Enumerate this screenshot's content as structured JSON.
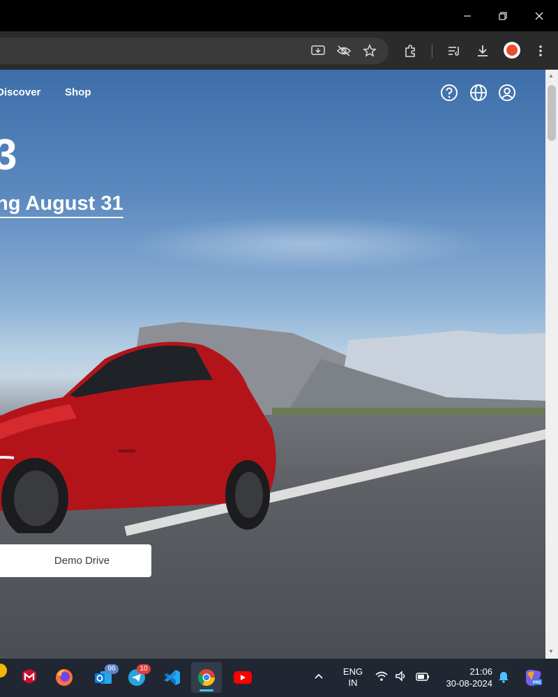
{
  "browser": {
    "window_controls": {
      "minimize": "minimize-icon",
      "maximize": "restore-icon",
      "close": "close-icon"
    },
    "toolbar_icons": [
      "install-app-icon",
      "eye-off-icon",
      "star-icon",
      "extensions-icon",
      "reading-list-icon",
      "download-icon",
      "profile-avatar",
      "more-vertical-icon"
    ]
  },
  "page": {
    "nav": {
      "discover_label": "Discover",
      "shop_label": "Shop",
      "icons": [
        "help-icon",
        "globe-icon",
        "account-icon"
      ]
    },
    "hero": {
      "title": "3",
      "subtitle": "ng August 31"
    },
    "cta": {
      "demo_drive_label": "Demo Drive"
    }
  },
  "taskbar": {
    "apps": [
      {
        "name": "mcafee-icon"
      },
      {
        "name": "firefox-icon"
      },
      {
        "name": "outlook-icon",
        "badge": "96"
      },
      {
        "name": "telegram-icon",
        "badge": "10"
      },
      {
        "name": "vscode-icon"
      },
      {
        "name": "chrome-icon",
        "active": true
      },
      {
        "name": "youtube-icon"
      }
    ],
    "tray": {
      "lang_line1": "ENG",
      "lang_line2": "IN",
      "time": "21:06",
      "date": "30-08-2024"
    }
  },
  "colors": {
    "tesla_red": "#c4161c",
    "taskbar_bg": "#202733",
    "toolbar_bg": "#2b2b2b"
  }
}
